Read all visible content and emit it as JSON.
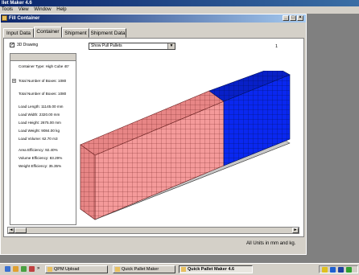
{
  "app": {
    "title": "llet Maker 4.6"
  },
  "menu": {
    "items": [
      "Tools",
      "View",
      "Window",
      "Help"
    ]
  },
  "child_window": {
    "title": "Fill Container",
    "min": "_",
    "max": "□",
    "close": "×"
  },
  "tabs": [
    "Input Data",
    "Container",
    "Shipment",
    "Shipment Data"
  ],
  "active_tab": "Container",
  "view": {
    "drawing_3d_label": "3D Drawing",
    "drawing_3d_checked": true,
    "check_mark": "✓",
    "pallet_view": "Show Pull Pallets",
    "dropdown_arrow": "▼",
    "page_number": "1"
  },
  "info": {
    "container_type": "Container Type: High Cube 40'",
    "total_boxes_expander": "Total Number of Boxes: 1080",
    "expander_glyph": "+",
    "total_boxes": "Total Number of Boxes: 1080",
    "load_length": "Load Length: 11145.00 mm",
    "load_width": "Load Width: 2320.00 mm",
    "load_height": "Load Height: 2675.00 mm",
    "load_weight": "Load Weight: 9084.00 kg",
    "load_volume": "Load Volume: 62.70 m3",
    "area_efficiency": "Area Efficiency: 92.40%",
    "volume_efficiency": "Volume Efficiency: 83.29%",
    "weight_efficiency": "Weight Efficiency: 35.35%"
  },
  "scroll": {
    "left": "◄",
    "right": "►"
  },
  "status": {
    "units": "All Units in mm and kg."
  },
  "taskbar": {
    "items": [
      "QPM Upload",
      "Quick Pallet Maker",
      "Quick Pallet Maker 4.6"
    ],
    "active": "Quick Pallet Maker 4.6",
    "chevron": "»"
  },
  "colors": {
    "load_pink": "#f49a9a",
    "load_blue": "#0a28f0",
    "container_wall": "#c0c0c0",
    "titlebar": "#0a246a"
  }
}
